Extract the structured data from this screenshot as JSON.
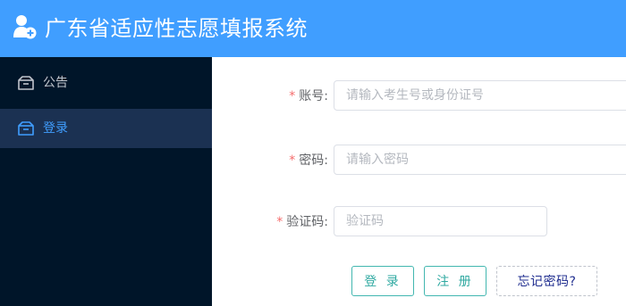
{
  "header": {
    "title": "广东省适应性志愿填报系统",
    "logo_icon": "user-add-icon"
  },
  "sidebar": {
    "items": [
      {
        "label": "公告",
        "icon": "notice-box-icon",
        "active": false
      },
      {
        "label": "登录",
        "icon": "login-box-icon",
        "active": true
      }
    ]
  },
  "form": {
    "account": {
      "label": "账号:",
      "required_mark": "*",
      "placeholder": "请输入考生号或身份证号",
      "value": ""
    },
    "password": {
      "label": "密码:",
      "required_mark": "*",
      "placeholder": "请输入密码",
      "value": ""
    },
    "captcha": {
      "label": "验证码:",
      "required_mark": "*",
      "placeholder": "验证码",
      "value": ""
    }
  },
  "buttons": {
    "login": "登 录",
    "register": "注 册",
    "forgot": "忘记密码?"
  },
  "colors": {
    "header": "#409eff",
    "sidebar": "#001529",
    "active_item_bg": "#1b3152",
    "accent": "#409eff",
    "button_border": "#42b7b0",
    "required": "#f56c6c"
  }
}
